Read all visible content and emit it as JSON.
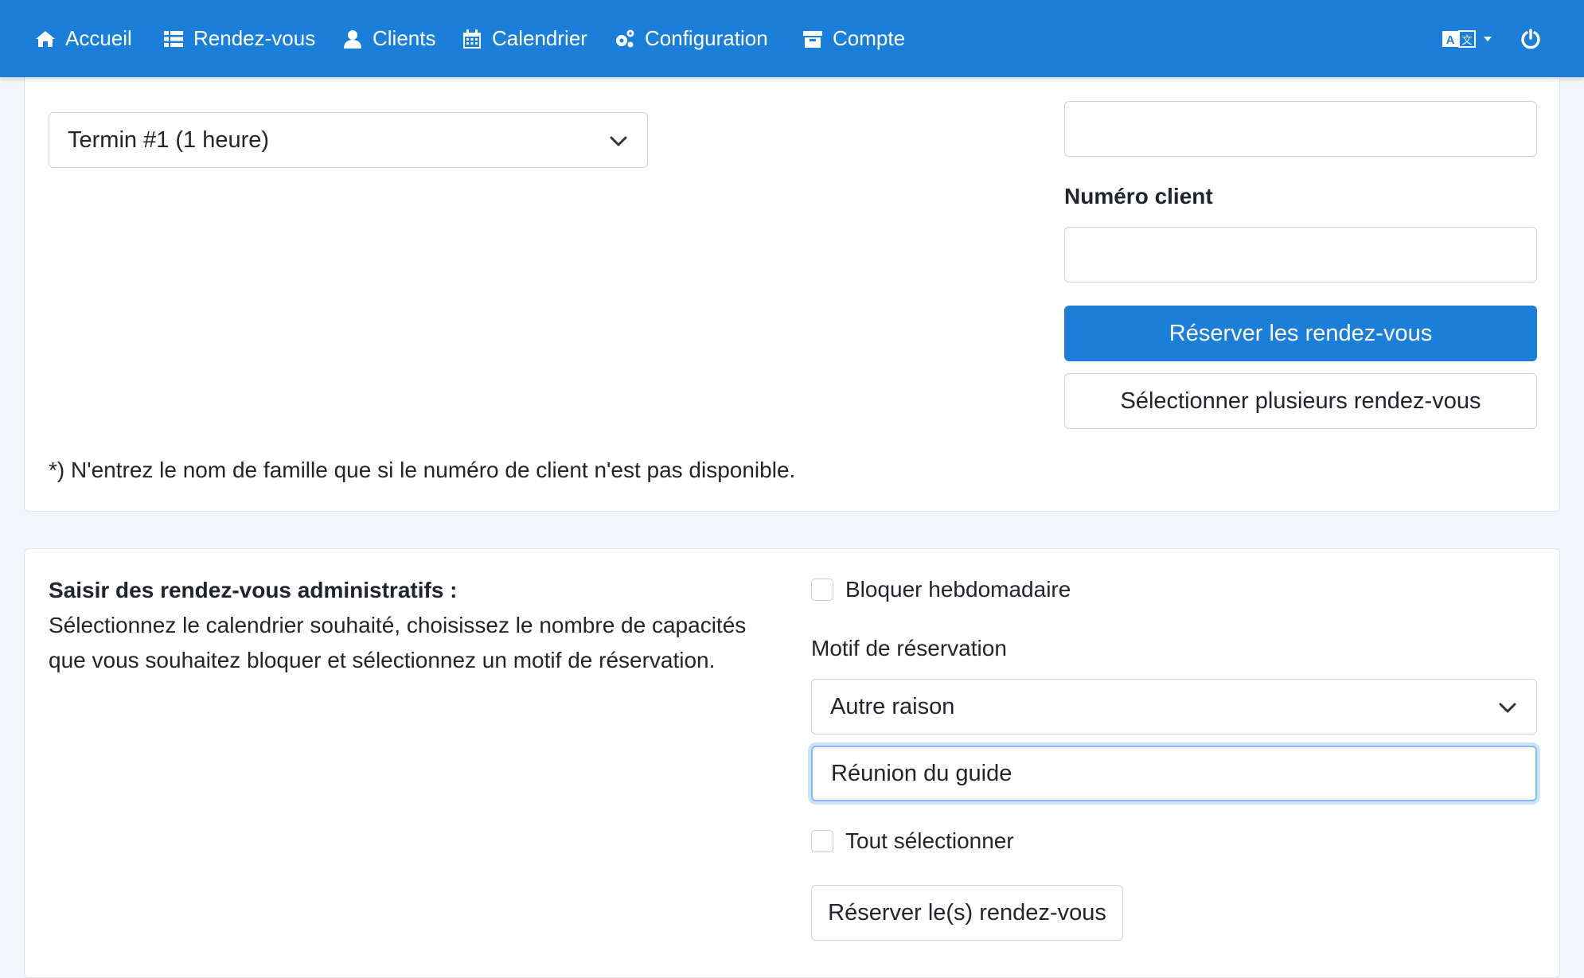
{
  "navbar": {
    "items": [
      {
        "label": "Accueil",
        "icon": "home-icon"
      },
      {
        "label": "Rendez-vous",
        "icon": "list-icon"
      },
      {
        "label": "Clients",
        "icon": "user-icon"
      },
      {
        "label": "Calendrier",
        "icon": "calendar-icon"
      },
      {
        "label": "Configuration",
        "icon": "gears-icon"
      },
      {
        "label": "Compte",
        "icon": "archive-icon"
      }
    ],
    "language_icon": "language-icon",
    "power_icon": "power-icon",
    "color": "#1b7fd9"
  },
  "booking": {
    "termin_select": "Termin #1 (1 heure)",
    "lastname_value": "",
    "customer_number_label": "Numéro client",
    "customer_number_value": "",
    "book_button": "Réserver les rendez-vous",
    "select_multiple_button": "Sélectionner plusieurs rendez-vous",
    "footnote": "*) N'entrez le nom de famille que si le numéro de client n'est pas disponible."
  },
  "admin": {
    "title": "Saisir des rendez-vous administratifs :",
    "description": "Sélectionnez le calendrier souhaité, choisissez le nombre de capacités que vous souhaitez bloquer et sélectionnez un motif de réservation.",
    "weekly_block_label": "Bloquer hebdomadaire",
    "reason_label": "Motif de réservation",
    "reason_select": "Autre raison",
    "reason_text": "Réunion du guide",
    "select_all_label": "Tout sélectionner",
    "book_button": "Réserver le(s) rendez-vous"
  }
}
